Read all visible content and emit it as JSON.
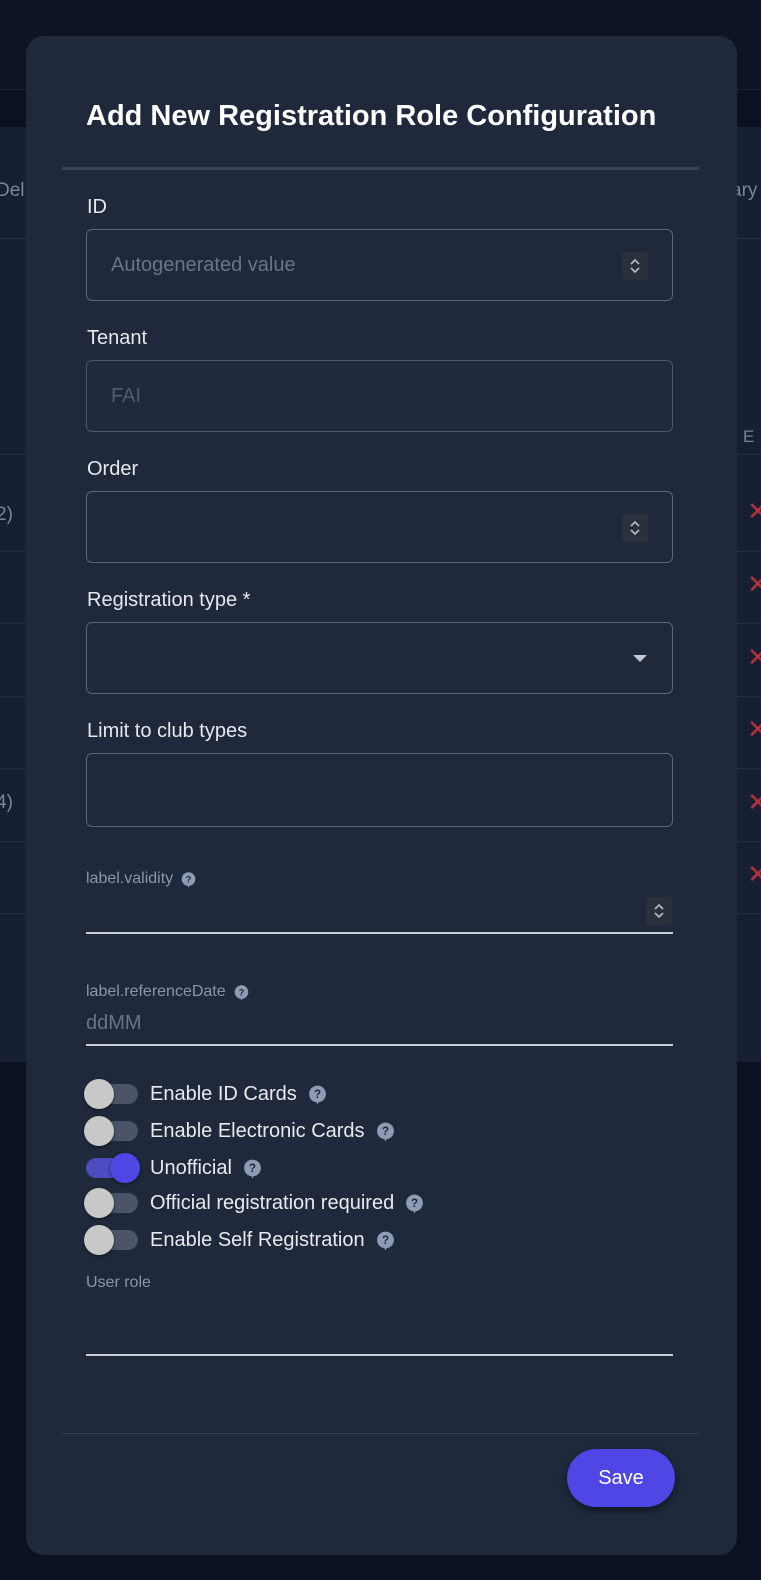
{
  "background": {
    "header_left": "Del",
    "header_right": "ary",
    "col_right": "E",
    "row_text_1": "2)",
    "row_text_2": "4)",
    "delete_glyph": "✕"
  },
  "modal": {
    "title": "Add New Registration Role Configuration",
    "fields": {
      "id": {
        "label": "ID",
        "placeholder": "Autogenerated value"
      },
      "tenant": {
        "label": "Tenant",
        "value": "FAI"
      },
      "order": {
        "label": "Order",
        "value": ""
      },
      "registration_type": {
        "label": "Registration type *",
        "value": ""
      },
      "club_types": {
        "label": "Limit to club types",
        "value": ""
      },
      "validity": {
        "label": "label.validity",
        "value": ""
      },
      "reference_date": {
        "label": "label.referenceDate",
        "placeholder": "ddMM"
      },
      "user_role": {
        "label": "User role",
        "value": ""
      }
    },
    "toggles": [
      {
        "label": "Enable ID Cards",
        "on": false
      },
      {
        "label": "Enable Electronic Cards",
        "on": false
      },
      {
        "label": "Unofficial",
        "on": true
      },
      {
        "label": "Official registration required",
        "on": false
      },
      {
        "label": "Enable Self Registration",
        "on": false
      }
    ],
    "save_label": "Save"
  },
  "colors": {
    "accent": "#4f46e5",
    "modal_bg": "#1f293b",
    "page_bg": "#0b1120",
    "danger": "#b3303e"
  }
}
